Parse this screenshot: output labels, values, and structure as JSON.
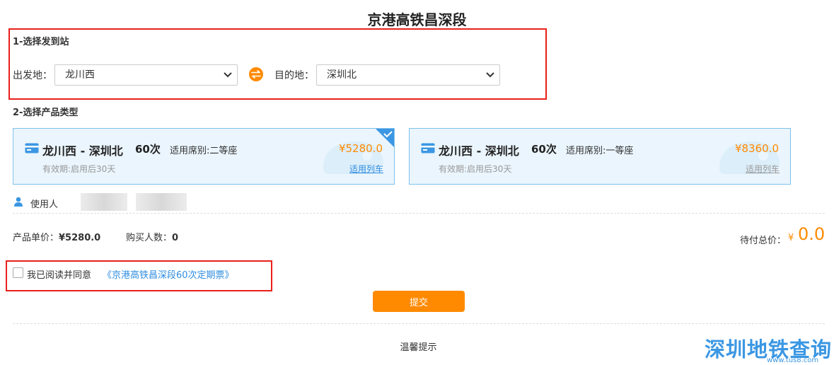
{
  "page": {
    "title": "京港高铁昌深段"
  },
  "section1": {
    "label": "1-选择发到站"
  },
  "origin": {
    "label": "出发地：",
    "value": "龙川西"
  },
  "destination": {
    "label": "目的地：",
    "value": "深圳北"
  },
  "section2": {
    "label": "2-选择产品类型"
  },
  "products": [
    {
      "route": "龙川西 - 深圳北",
      "count": "60次",
      "seat": "适用席别:二等座",
      "price": "¥5280.0",
      "validity": "有效期:启用后30天",
      "trains_link": "适用列车",
      "selected": true
    },
    {
      "route": "龙川西 - 深圳北",
      "count": "60次",
      "seat": "适用席别:一等座",
      "price": "¥8360.0",
      "validity": "有效期:启用后30天",
      "trains_link": "适用列车",
      "selected": false
    }
  ],
  "user": {
    "label": "使用人"
  },
  "summary": {
    "unit_price_label": "产品单价：",
    "unit_price": "¥5280.0",
    "buyers_label": "购买人数：",
    "buyers": "0",
    "total_label": "待付总价：",
    "total_currency": "¥",
    "total_value": "0.0"
  },
  "agreement": {
    "text": "我已阅读并同意",
    "link": "《京港高铁昌深段60次定期票》"
  },
  "submit": {
    "label": "提交"
  },
  "tips": {
    "label": "温馨提示"
  },
  "brand": {
    "name": "深圳地铁查询",
    "url": "www.tus8.com"
  },
  "colors": {
    "accent": "#ff8a00",
    "link": "#2e8de0",
    "card_bg": "#eaf5fd",
    "card_border": "#7fc1ee",
    "highlight": "#e8201a"
  }
}
